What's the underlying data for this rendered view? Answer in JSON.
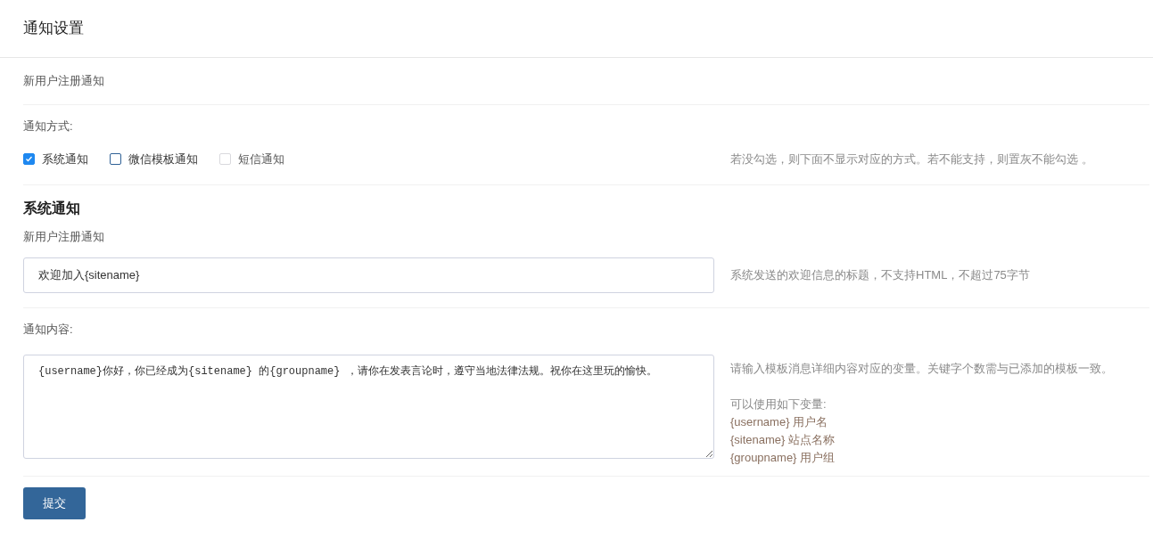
{
  "title": "通知设置",
  "section_label": "新用户注册通知",
  "method": {
    "label": "通知方式:",
    "options": [
      {
        "label": "系统通知",
        "checked": true,
        "disabled": false
      },
      {
        "label": "微信模板通知",
        "checked": false,
        "disabled": false
      },
      {
        "label": "短信通知",
        "checked": false,
        "disabled": true
      }
    ],
    "help": "若没勾选，则下面不显示对应的方式。若不能支持，则置灰不能勾选 。"
  },
  "system": {
    "heading": "系统通知",
    "title_label": "新用户注册通知",
    "title_value": "欢迎加入{sitename}",
    "title_help": "系统发送的欢迎信息的标题，不支持HTML，不超过75字节",
    "content_label": "通知内容:",
    "content_value": "{username}你好，你已经成为{sitename} 的{groupname} ，请你在发表言论时，遵守当地法律法规。祝你在这里玩的愉快。",
    "content_help": "请输入模板消息详细内容对应的变量。关键字个数需与已添加的模板一致。",
    "vars_heading": "可以使用如下变量:",
    "variables": [
      "{username} 用户名",
      "{sitename} 站点名称",
      "{groupname} 用户组"
    ]
  },
  "submit": "提交"
}
